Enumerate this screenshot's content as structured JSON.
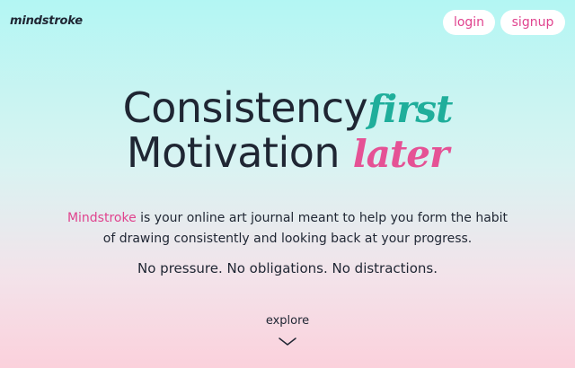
{
  "header": {
    "logo": "mindstroke",
    "login_label": "login",
    "signup_label": "signup"
  },
  "hero": {
    "line1_main": "Consistency",
    "line1_accent": "first",
    "line2_main": "Motivation",
    "line2_accent": "later"
  },
  "description": {
    "brand": "Mindstroke",
    "text_part1": " is your online art journal meant to help you form the habit",
    "text_part2": "of drawing consistently and looking back at your progress."
  },
  "tagline": "No pressure. No obligations. No distractions.",
  "explore_label": "explore",
  "icons": {
    "scroll": "chevron-down-icon"
  },
  "colors": {
    "accent_pink": "#e0438e",
    "accent_teal": "#1fae9b",
    "text_dark": "#1f2633",
    "bg_top": "#b3f6f3",
    "bg_bottom": "#fbd1dc"
  }
}
